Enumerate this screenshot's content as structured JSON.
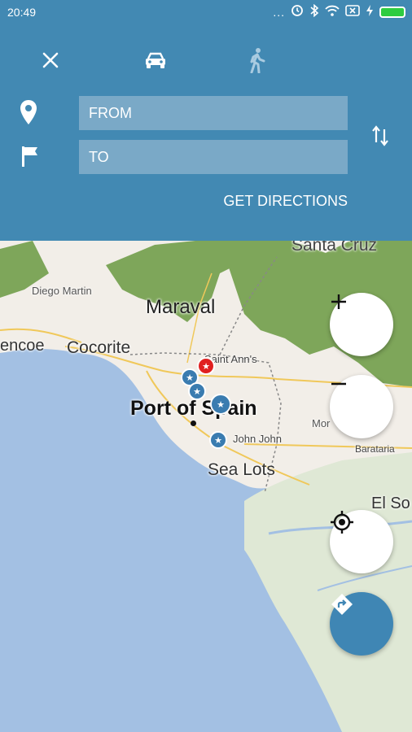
{
  "status_bar": {
    "time": "20:49",
    "dots": "...",
    "icons": [
      "alarm-icon",
      "bluetooth-icon",
      "wifi-icon",
      "sim-icon",
      "charging-icon",
      "battery-icon"
    ],
    "battery_color": "#2ecc40"
  },
  "header": {
    "background": "#4289b3",
    "mode_icons": [
      "close-icon",
      "car-icon",
      "walk-icon"
    ],
    "from_placeholder": "FROM",
    "to_placeholder": "TO",
    "get_directions_label": "GET DIRECTIONS"
  },
  "map": {
    "labels": {
      "santa_cruz": "Santa Cruz",
      "diego_martin": "Diego Martin",
      "maraval": "Maraval",
      "encoe": "encoe",
      "cocorite": "Cocorite",
      "saint_anns": "Saint Ann's",
      "port_of_spain": "Port of Spain",
      "john_john": "John John",
      "sea_lots": "Sea Lots",
      "morvant": "Mor",
      "barataria": "Barataria",
      "el_so": "El So"
    },
    "marker_glyph": "★",
    "zoom_in_glyph": "+",
    "zoom_out_glyph": "−",
    "accent": "#3f86b4"
  }
}
